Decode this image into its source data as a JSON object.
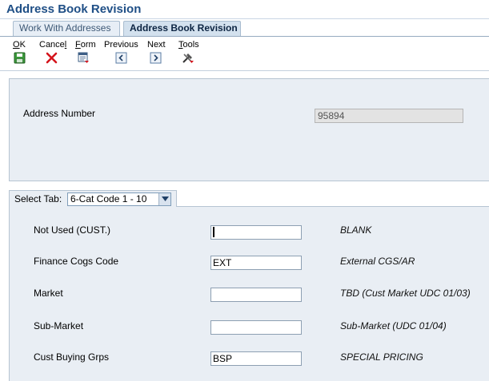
{
  "window": {
    "title": "Address Book Revision"
  },
  "tabs": [
    {
      "label": "Work With Addresses",
      "active": false
    },
    {
      "label": "Address Book Revision",
      "active": true
    }
  ],
  "toolbar": {
    "ok": {
      "label": "OK",
      "mnemonic": "O",
      "rest": "K",
      "icon": "save-icon"
    },
    "cancel": {
      "label": "Cancel",
      "pre": "Cance",
      "mnemonic": "l",
      "icon": "cancel-x-icon"
    },
    "form": {
      "label": "Form",
      "mnemonic": "F",
      "rest": "orm",
      "icon": "form-menu-icon"
    },
    "previous": {
      "label": "Previous",
      "icon": "chevron-left-icon"
    },
    "next": {
      "label": "Next",
      "icon": "chevron-right-icon"
    },
    "tools": {
      "label": "Tools",
      "mnemonic": "T",
      "rest": "ools",
      "icon": "tools-icon"
    }
  },
  "header": {
    "address_number_label": "Address Number",
    "address_number_value": "95894"
  },
  "tab_selector": {
    "label": "Select Tab:",
    "selected": "6-Cat Code 1 - 10"
  },
  "rows": [
    {
      "label": "Not Used (CUST.)",
      "value": "",
      "description": "BLANK"
    },
    {
      "label": "Finance Cogs Code",
      "value": "EXT",
      "description": "External CGS/AR"
    },
    {
      "label": "Market",
      "value": "",
      "description": "TBD (Cust Market UDC 01/03)"
    },
    {
      "label": "Sub-Market",
      "value": "",
      "description": "Sub-Market (UDC 01/04)"
    },
    {
      "label": "Cust Buying Grps",
      "value": "BSP",
      "description": "SPECIAL PRICING"
    }
  ],
  "colors": {
    "title": "#1f4f86",
    "panel_bg": "#e9eef4",
    "panel_border": "#b6c4d2",
    "cancel_red": "#d4141c",
    "ok_green": "#2c8a2c"
  }
}
